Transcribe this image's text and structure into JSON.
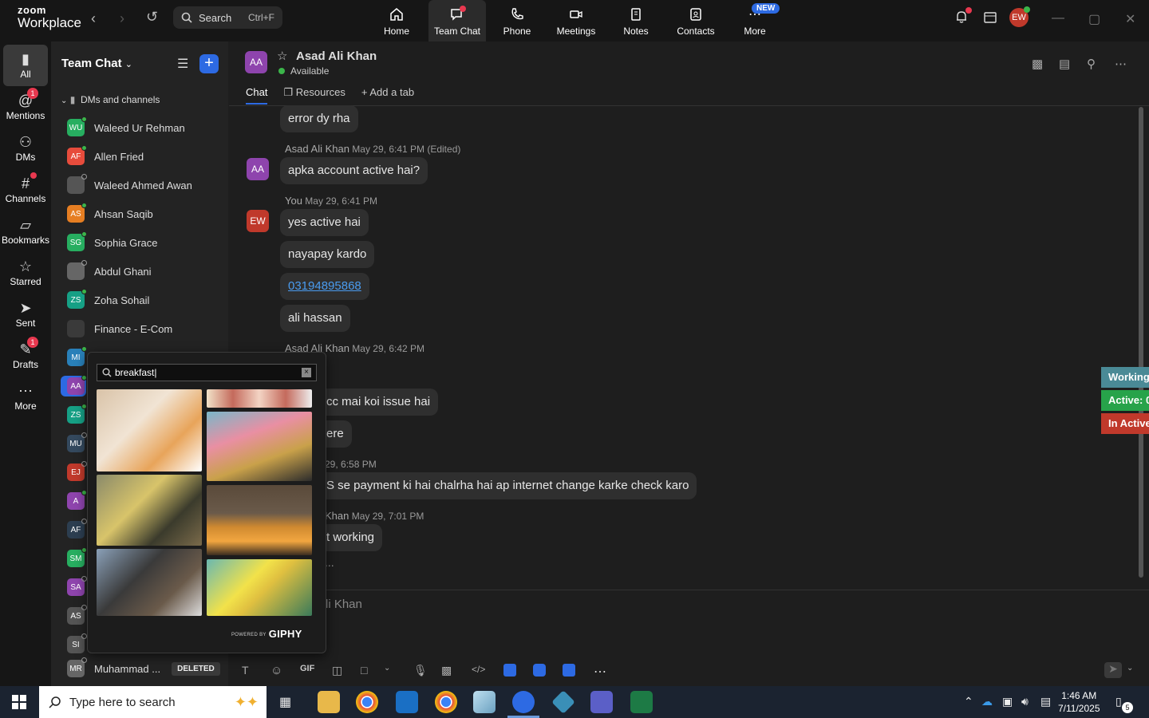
{
  "app": {
    "logo_line1": "zoom",
    "logo_line2": "Workplace"
  },
  "topbar": {
    "search_label": "Search",
    "search_shortcut": "Ctrl+F",
    "tabs": [
      {
        "label": "Home",
        "icon": "home-icon"
      },
      {
        "label": "Team Chat",
        "icon": "chat-icon",
        "active": true
      },
      {
        "label": "Phone",
        "icon": "phone-icon"
      },
      {
        "label": "Meetings",
        "icon": "video-camera-icon"
      },
      {
        "label": "Notes",
        "icon": "notes-icon"
      },
      {
        "label": "Contacts",
        "icon": "contacts-icon"
      },
      {
        "label": "More",
        "icon": "more-icon"
      }
    ],
    "new_badge": "NEW",
    "user_initials": "EW"
  },
  "rail": {
    "items": [
      {
        "label": "All",
        "icon": "chat-bubble-icon"
      },
      {
        "label": "Mentions",
        "icon": "at-icon",
        "badge": "1"
      },
      {
        "label": "DMs",
        "icon": "people-icon"
      },
      {
        "label": "Channels",
        "icon": "hash-icon"
      },
      {
        "label": "Bookmarks",
        "icon": "bookmark-icon"
      },
      {
        "label": "Starred",
        "icon": "star-icon"
      },
      {
        "label": "Sent",
        "icon": "send-icon"
      },
      {
        "label": "Drafts",
        "icon": "draft-icon",
        "badge": "1"
      },
      {
        "label": "More",
        "icon": "ellipsis-icon"
      }
    ]
  },
  "sidebar": {
    "title": "Team Chat",
    "section": "DMs and channels",
    "rows": [
      {
        "initials": "WU",
        "name": "Waleed Ur Rehman",
        "color": "#27ae60"
      },
      {
        "initials": "AF",
        "name": "Allen Fried",
        "color": "#e74c3c"
      },
      {
        "initials": "",
        "name": "Waleed Ahmed Awan",
        "color": "#555555"
      },
      {
        "initials": "AS",
        "name": "Ahsan Saqib",
        "color": "#e67e22"
      },
      {
        "initials": "SG",
        "name": "Sophia Grace",
        "color": "#27ae60"
      },
      {
        "initials": "",
        "name": "Abdul Ghani",
        "color": "#666666"
      },
      {
        "initials": "ZS",
        "name": "Zoha Sohail",
        "color": "#16a085"
      },
      {
        "initials": "",
        "name": "Finance - E-Com",
        "color": "#3a3a3a"
      },
      {
        "initials": "MI",
        "name": "",
        "color": "#2980b9"
      },
      {
        "initials": "AA",
        "name": "",
        "color": "#8e44ad"
      },
      {
        "initials": "ZS",
        "name": "",
        "color": "#16a085"
      },
      {
        "initials": "MU",
        "name": "",
        "color": "#34495e"
      },
      {
        "initials": "EJ",
        "name": "",
        "color": "#c0392b"
      },
      {
        "initials": "A",
        "name": "",
        "color": "#8e44ad"
      },
      {
        "initials": "AF",
        "name": "",
        "color": "#2c3e50"
      },
      {
        "initials": "SM",
        "name": "",
        "color": "#27ae60"
      },
      {
        "initials": "SA",
        "name": "",
        "color": "#8e44ad"
      },
      {
        "initials": "AS",
        "name": "",
        "color": "#555555"
      },
      {
        "initials": "SI",
        "name": "",
        "color": "#555555"
      },
      {
        "initials": "MR",
        "name": "Muhammad ...",
        "color": "#666666"
      }
    ],
    "deleted_tag": "DELETED"
  },
  "chat": {
    "contact_initials": "AA",
    "contact_name": "Asad Ali Khan",
    "contact_status": "Available",
    "tabs": [
      "Chat",
      "Resources",
      "Add a tab"
    ],
    "messages": {
      "m1": "error dy rha",
      "meta1_name": "Asad Ali Khan",
      "meta1_time": "May 29, 6:41 PM (Edited)",
      "m2": "apka account active hai?",
      "meta2_name": "You",
      "meta2_time": "May 29, 6:41 PM",
      "m3": "yes active hai",
      "m4": "nayapay kardo",
      "m5": "03194895868",
      "m6": "ali hassan",
      "meta3_name": "Asad Ali Khan",
      "meta3_time": "May 29, 6:42 PM",
      "m7": "cc mai koi issue hai",
      "m8": "ere",
      "meta4_time": "29, 6:58 PM",
      "m9": "S se payment ki hai chalrha hai ap internet change karke check karo",
      "meta5_name": "Khan",
      "meta5_time": "May 29, 7:01 PM",
      "m10": "t working",
      "m11": "..."
    },
    "my_initials": "EW",
    "compose_placeholder": "li Khan",
    "compose_gif": "GIF"
  },
  "side_tags": [
    {
      "label": "Working",
      "color": "#4a8a96"
    },
    {
      "label": "Active: 0",
      "color": "#27a34a"
    },
    {
      "label": "In Active",
      "color": "#c0392b"
    }
  ],
  "gif_picker": {
    "query": "breakfast",
    "powered_by": "POWERED BY",
    "brand": "GIPHY"
  },
  "taskbar": {
    "search_placeholder": "Type here to search",
    "time": "1:46 AM",
    "date": "7/11/2025",
    "notif_count": "5"
  }
}
